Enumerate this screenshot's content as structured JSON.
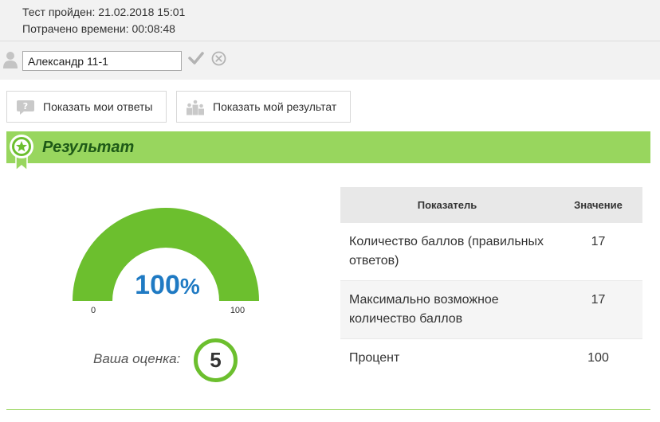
{
  "header": {
    "test_passed": "Тест пройден: 21.02.2018 15:01",
    "time_spent": "Потрачено времени: 00:08:48"
  },
  "user": {
    "name_value": "Александр 11-1"
  },
  "buttons": {
    "show_answers": "Показать мои ответы",
    "show_result": "Показать мой результат"
  },
  "result": {
    "title": "Результат",
    "gauge": {
      "percent_value": 100,
      "percent_number": "100",
      "percent_sign": "%",
      "min": "0",
      "max": "100"
    },
    "grade_label": "Ваша оценка:",
    "grade": "5"
  },
  "table": {
    "headers": [
      "Показатель",
      "Значение"
    ],
    "rows": [
      {
        "name": "Количество баллов (правильных ответов)",
        "value": "17"
      },
      {
        "name": "Максимально возможное количество баллов",
        "value": "17"
      },
      {
        "name": "Процент",
        "value": "100"
      }
    ]
  },
  "colors": {
    "accent_green": "#6cbf2e",
    "result_bar": "#98d65e",
    "title_green": "#1e5a17",
    "percent_blue": "#1f7ac3"
  }
}
